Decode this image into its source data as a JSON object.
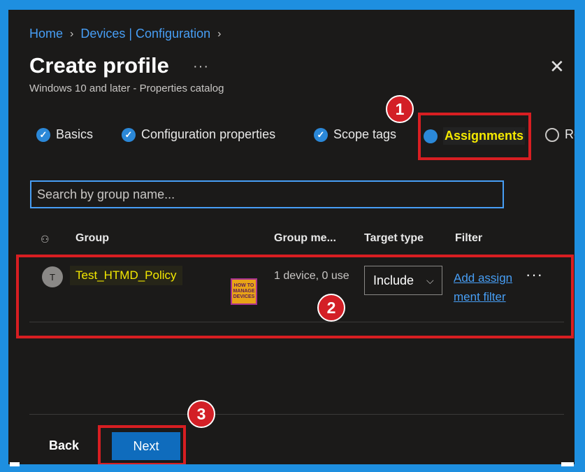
{
  "breadcrumb": {
    "items": [
      "Home",
      "Devices | Configuration"
    ]
  },
  "header": {
    "title": "Create profile",
    "more": "···",
    "close": "✕",
    "subtitle": "Windows 10 and later - Properties catalog"
  },
  "steps": [
    {
      "label": "Basics",
      "state": "done"
    },
    {
      "label": "Configuration properties",
      "state": "done"
    },
    {
      "label": "Scope tags",
      "state": "done"
    },
    {
      "label": "Assignments",
      "state": "active"
    },
    {
      "label": "Re",
      "state": "pending"
    }
  ],
  "search": {
    "placeholder": "Search by group name..."
  },
  "table": {
    "headers": {
      "group": "Group",
      "members": "Group me...",
      "target": "Target type",
      "filter": "Filter"
    },
    "rows": [
      {
        "avatar": "T",
        "group": "Test_HTMD_Policy",
        "members": "1 device, 0 use",
        "target_type": "Include",
        "filter": "Add assignment filter",
        "more": "···"
      }
    ]
  },
  "watermark": {
    "text": "HOW TO MANAGE DEVICES"
  },
  "annotations": {
    "badge1": "1",
    "badge2": "2",
    "badge3": "3"
  },
  "footer": {
    "back": "Back",
    "next": "Next"
  },
  "colors": {
    "accent": "#479ef5",
    "highlight_box": "#d81e22",
    "highlight_text": "#f4e900",
    "primary_button": "#0f6cbd"
  }
}
